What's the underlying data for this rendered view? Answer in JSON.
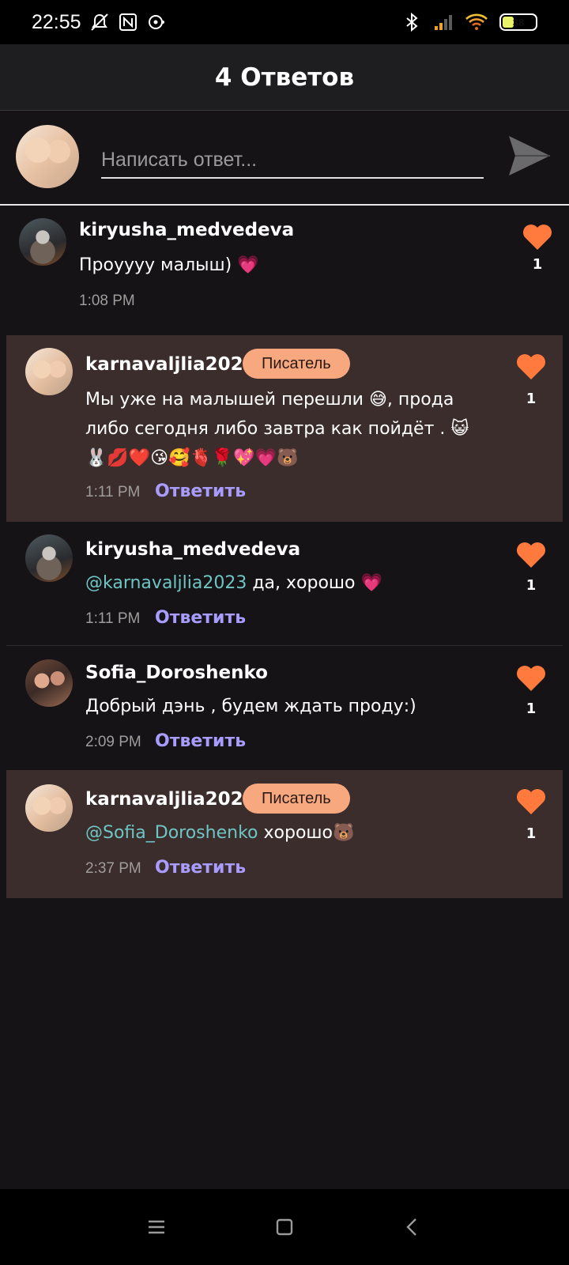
{
  "status": {
    "time": "22:55",
    "battery": "38",
    "icons": [
      "mute-bell-icon",
      "nfc-icon",
      "media-icon",
      "bluetooth-icon",
      "signal-icon",
      "wifi-icon",
      "battery-icon"
    ]
  },
  "header": {
    "title": "4 Ответов"
  },
  "reply_box": {
    "placeholder": "Написать ответ..."
  },
  "colors": {
    "accent_like": "#ff7a3c",
    "reply_link": "#a99cff",
    "mention": "#6fc5c3",
    "badge": "#f8a87f",
    "writer_bg": "#3b2d2b"
  },
  "comments": [
    {
      "username": "kiryusha_medvedeva",
      "text": "Проуууу малыш) 💗",
      "time": "1:08 PM",
      "likes": "1"
    },
    {
      "username": "karnavaljlia2023",
      "badge": "Писатель",
      "text_line1": "Мы уже на малышей перешли 😅,  прода",
      "text_line2": "либо сегодня либо завтра как пойдёт . 😺",
      "text_line3": "🐰💋❤️😘🥰🫀🌹💖💗🐻",
      "time": "1:11 PM",
      "reply": "Ответить",
      "likes": "1"
    },
    {
      "username": "kiryusha_medvedeva",
      "mention": "@karnavaljlia2023",
      "text": " да, хорошо 💗",
      "time": "1:11 PM",
      "reply": "Ответить",
      "likes": "1"
    },
    {
      "username": "Sofia_Doroshenko",
      "text": "Добрый дэнь , будем ждать проду:)",
      "time": "2:09 PM",
      "reply": "Ответить",
      "likes": "1"
    },
    {
      "username": "karnavaljlia2023",
      "badge": "Писатель",
      "mention": "@Sofia_Doroshenko",
      "text": "  хорошо🐻",
      "time": "2:37 PM",
      "reply": "Ответить",
      "likes": "1"
    }
  ]
}
